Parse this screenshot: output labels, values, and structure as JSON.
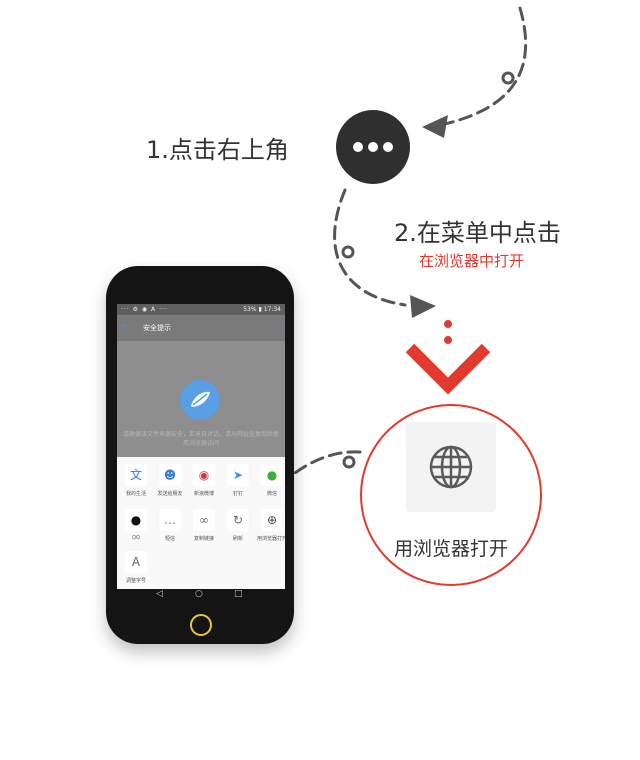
{
  "step1": {
    "text": "1.点击右上角"
  },
  "step2": {
    "text": "2.在菜单中点击",
    "sub": "在浏览器中打开"
  },
  "phone": {
    "status_bar": {
      "left": "··· ⚙ ◉ A ···",
      "battery": "53%",
      "time": "17:34"
    },
    "title": "安全提示",
    "warning_text": "请确保该文件来源安全，若来自对话，请从网址处复制后使用浏览器访问",
    "share_items": [
      {
        "label": "我的生活",
        "icon": "translate-icon",
        "glyph": "文",
        "color": "#2f7bd8"
      },
      {
        "label": "发送给朋友",
        "icon": "contacts-icon",
        "glyph": "☻",
        "color": "#3a7fd1"
      },
      {
        "label": "新浪微博",
        "icon": "weibo-icon",
        "glyph": "◉",
        "color": "#e2312d"
      },
      {
        "label": "钉钉",
        "icon": "dingtalk-icon",
        "glyph": "➤",
        "color": "#3a96e8"
      },
      {
        "label": "微信",
        "icon": "wechat-icon",
        "glyph": "●",
        "color": "#3cb034"
      },
      {
        "label": "QQ",
        "icon": "qq-icon",
        "glyph": "●",
        "color": "#111111"
      },
      {
        "label": "短信",
        "icon": "sms-icon",
        "glyph": "…",
        "color": "#3cb034"
      },
      {
        "label": "复制链接",
        "icon": "link-icon",
        "glyph": "∞",
        "color": "#666666"
      },
      {
        "label": "刷新",
        "icon": "refresh-icon",
        "glyph": "↻",
        "color": "#666666"
      },
      {
        "label": "用浏览器打开",
        "icon": "globe-icon",
        "glyph": "⊕",
        "color": "#444444"
      },
      {
        "label": "调整字号",
        "icon": "font-size-icon",
        "glyph": "A",
        "color": "#666666"
      }
    ]
  },
  "zoom": {
    "label": "用浏览器打开",
    "icon": "globe-icon"
  },
  "colors": {
    "accent": "#e33a30",
    "dark": "#2f2f2f"
  }
}
